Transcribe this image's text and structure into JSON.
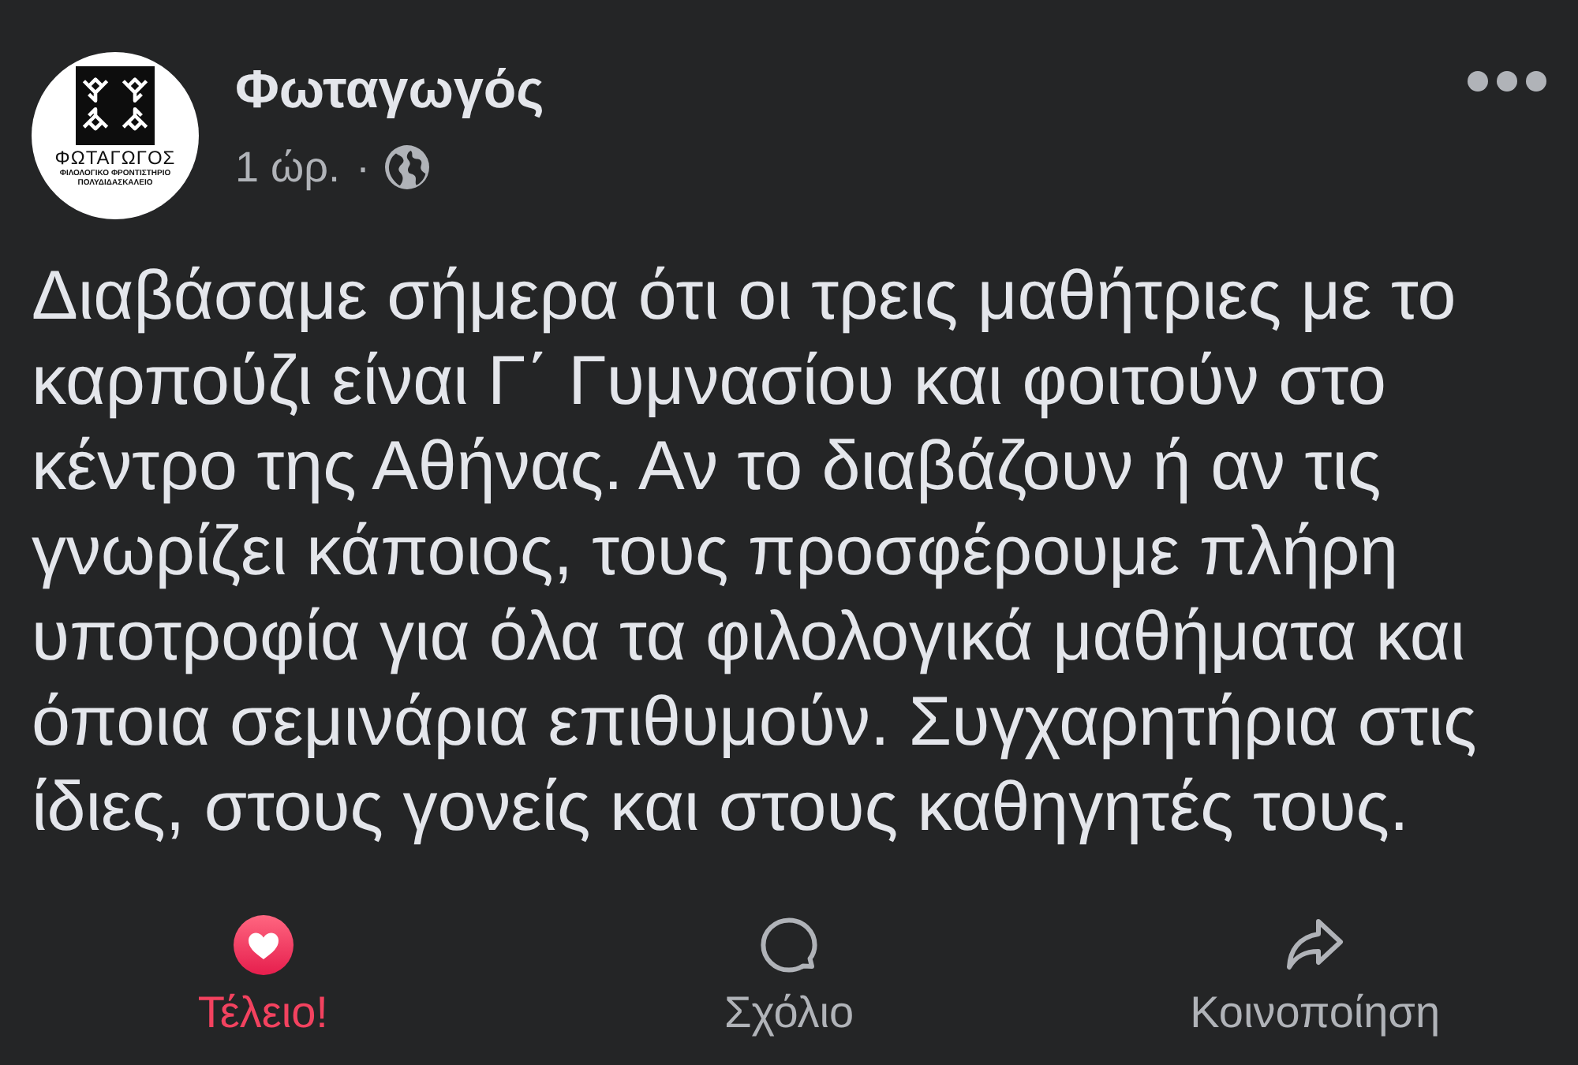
{
  "post": {
    "author": {
      "name": "Φωταγωγός",
      "logo": {
        "wordmark": "ΦΩΤΑΓΩΓΟΣ",
        "tagline": [
          "ΦΙΛΟΛΟΓΙΚΟ ΦΡΟΝΤΙΣΤΗΡΙΟ",
          "ΠΟΛΥΔΙΔΑΣΚΑΛΕΙΟ"
        ]
      }
    },
    "time": "1 ώρ.",
    "separator": "·",
    "text": "Διαβάσαμε σήμερα ότι οι τρεις μαθήτριες με το καρπούζι είναι Γ΄ Γυμνασίου και φοιτούν στο κέντρο της Αθήνας. Αν το διαβάζουν ή αν τις γνωρίζει κάποιος, τους προσφέρουμε πλήρη υποτροφία για όλα τα φιλολογικά μαθήματα και όποια σεμινάρια επιθυμούν. Συγχαρητήρια στις ίδιες, στους γονείς και στους καθηγητές τους."
  },
  "actions": [
    {
      "kind": "reaction",
      "label": "Τέλειο!",
      "active": true
    },
    {
      "kind": "comment",
      "label": "Σχόλιο",
      "active": false
    },
    {
      "kind": "share",
      "label": "Κοινοποίηση",
      "active": false
    }
  ]
}
